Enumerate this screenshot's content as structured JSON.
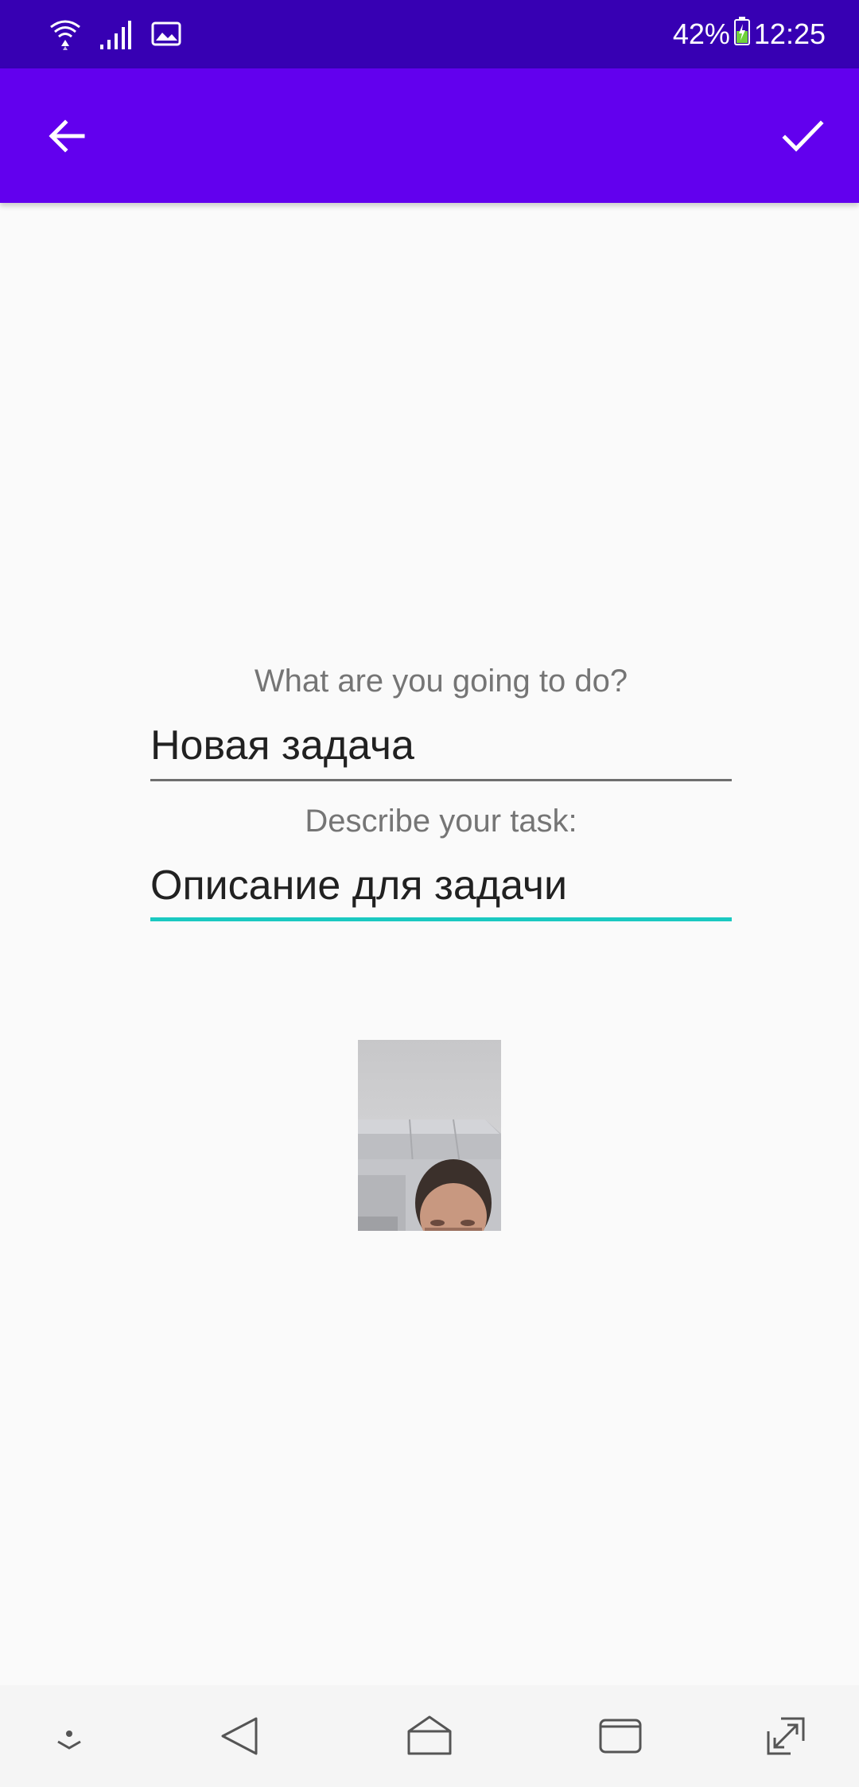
{
  "status_bar": {
    "battery": "42%",
    "time": "12:25",
    "icons": [
      "wifi-icon",
      "signal-icon",
      "image-notification-icon",
      "battery-charging-icon"
    ]
  },
  "app_bar": {
    "back_icon": "arrow-back-icon",
    "confirm_icon": "check-icon",
    "background": "#6200ee",
    "status_background": "#3700b3"
  },
  "form": {
    "title_label": "What are you going to do?",
    "title_value": "Новая задача",
    "description_label": "Describe your task:",
    "description_value": "Описание для задачи",
    "focus_accent": "#1ac9c1"
  },
  "attachment": {
    "icon": "photo-thumbnail"
  },
  "nav_bar": {
    "icons": [
      "hide-nav-icon",
      "back-triangle-icon",
      "home-icon",
      "recents-icon",
      "fullscreen-icon"
    ]
  }
}
